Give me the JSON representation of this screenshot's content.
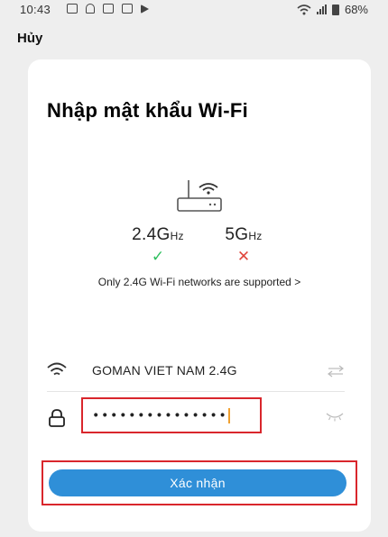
{
  "status_bar": {
    "time": "10:43",
    "battery": "68%"
  },
  "header": {
    "cancel_label": "Hủy"
  },
  "card": {
    "title": "Nhập mật khẩu Wi-Fi",
    "bands": {
      "band_24": {
        "value": "2.4G",
        "unit": "Hz",
        "mark": "✓"
      },
      "band_5": {
        "value": "5G",
        "unit": "Hz",
        "mark": "✕"
      }
    },
    "support_note": "Only 2.4G Wi-Fi networks are supported >",
    "ssid": "GOMAN VIET NAM 2.4G",
    "password_mask": "•••••••••••••••",
    "confirm_label": "Xác nhận"
  },
  "colors": {
    "accent": "#2f8fd8",
    "highlight": "#d9262c",
    "check": "#2fbf5f",
    "cross": "#e0463c"
  }
}
